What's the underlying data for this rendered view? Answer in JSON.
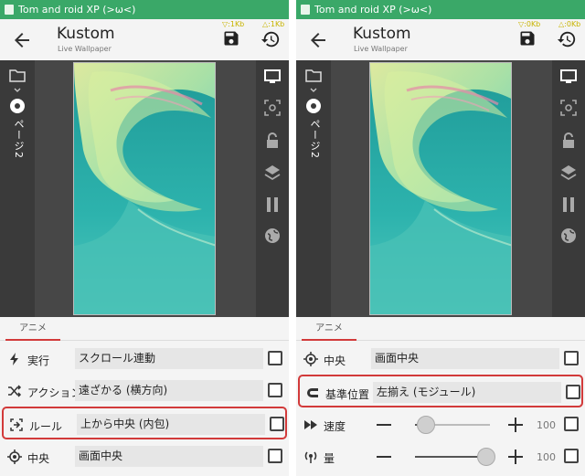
{
  "status_title": "Tom and roid XP (>ω<)",
  "app": {
    "title": "Kustom",
    "subtitle": "Live Wallpaper"
  },
  "sizes": {
    "left": [
      "▽:1Kb",
      "△:1Kb"
    ],
    "right": [
      "▽:0Kb",
      "△:0Kb"
    ]
  },
  "page_label": "ページ2",
  "tab_label": "アニメ",
  "left_rows": [
    {
      "label": "実行",
      "value": "スクロール連動",
      "icon": "lightning-icon"
    },
    {
      "label": "アクション",
      "value": "遠ざかる (横方向)",
      "icon": "shuffle-icon"
    },
    {
      "label": "ルール",
      "value": "上から中央 (内包)",
      "icon": "rule-icon"
    },
    {
      "label": "中央",
      "value": "画面中央",
      "icon": "crosshair-icon"
    }
  ],
  "right_rows": [
    {
      "label": "中央",
      "value": "画面中央",
      "icon": "crosshair-icon"
    },
    {
      "label": "基準位置",
      "value": "左揃え (モジュール)",
      "icon": "magnet-icon"
    }
  ],
  "sliders": [
    {
      "label": "速度",
      "value": "100",
      "fraction": 0.15,
      "icon": "fast-forward-icon"
    },
    {
      "label": "量",
      "value": "100",
      "fraction": 0.95,
      "icon": "signal-icon"
    }
  ],
  "colors": {
    "status_bar": "#3aa868",
    "highlight": "#d23a3a",
    "preview_bg": "#2aa8a4"
  }
}
